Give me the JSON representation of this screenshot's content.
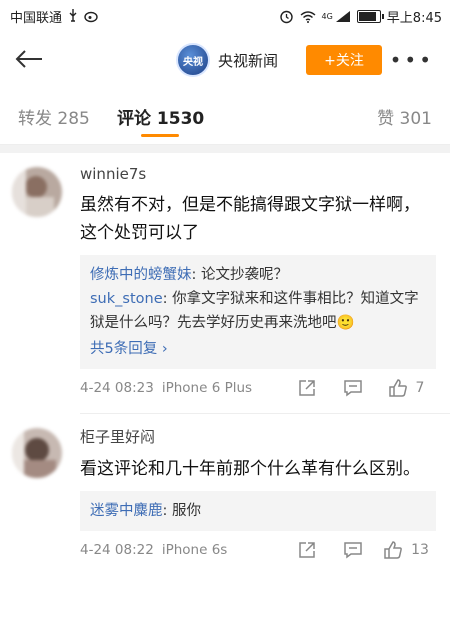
{
  "status_bar": {
    "carrier": "中国联通",
    "time": "早上8:45",
    "network": "4G"
  },
  "nav": {
    "account_name": "央视新闻",
    "follow_label": "+关注",
    "avatar_text": "央视"
  },
  "tabs": {
    "reposts": "转发 285",
    "comments": "评论 1530",
    "likes": "赞 301"
  },
  "comments": [
    {
      "username": "winnie7s",
      "text": "虽然有不对，但是不能搞得跟文字狱一样啊，这个处罚可以了",
      "replies": [
        {
          "name": "修炼中的螃蟹妹",
          "text": ": 论文抄袭呢？"
        },
        {
          "name": "suk_stone",
          "text": ": 你拿文字狱来和这件事相比？知道文字狱是什么吗？先去学好历史再来洗地吧🙂"
        }
      ],
      "more_replies": "共5条回复 ›",
      "timestamp": "4-24 08:23",
      "device": "iPhone 6 Plus",
      "likes": "7"
    },
    {
      "username": "柜子里好闷",
      "text": "看这评论和几十年前那个什么革有什么区别。",
      "replies": [
        {
          "name": "迷雾中麋鹿",
          "text": ": 服你"
        }
      ],
      "timestamp": "4-24 08:22",
      "device": "iPhone 6s",
      "likes": "13"
    }
  ],
  "colors": {
    "accent": "#ff8a00",
    "link": "#3e6db5"
  }
}
